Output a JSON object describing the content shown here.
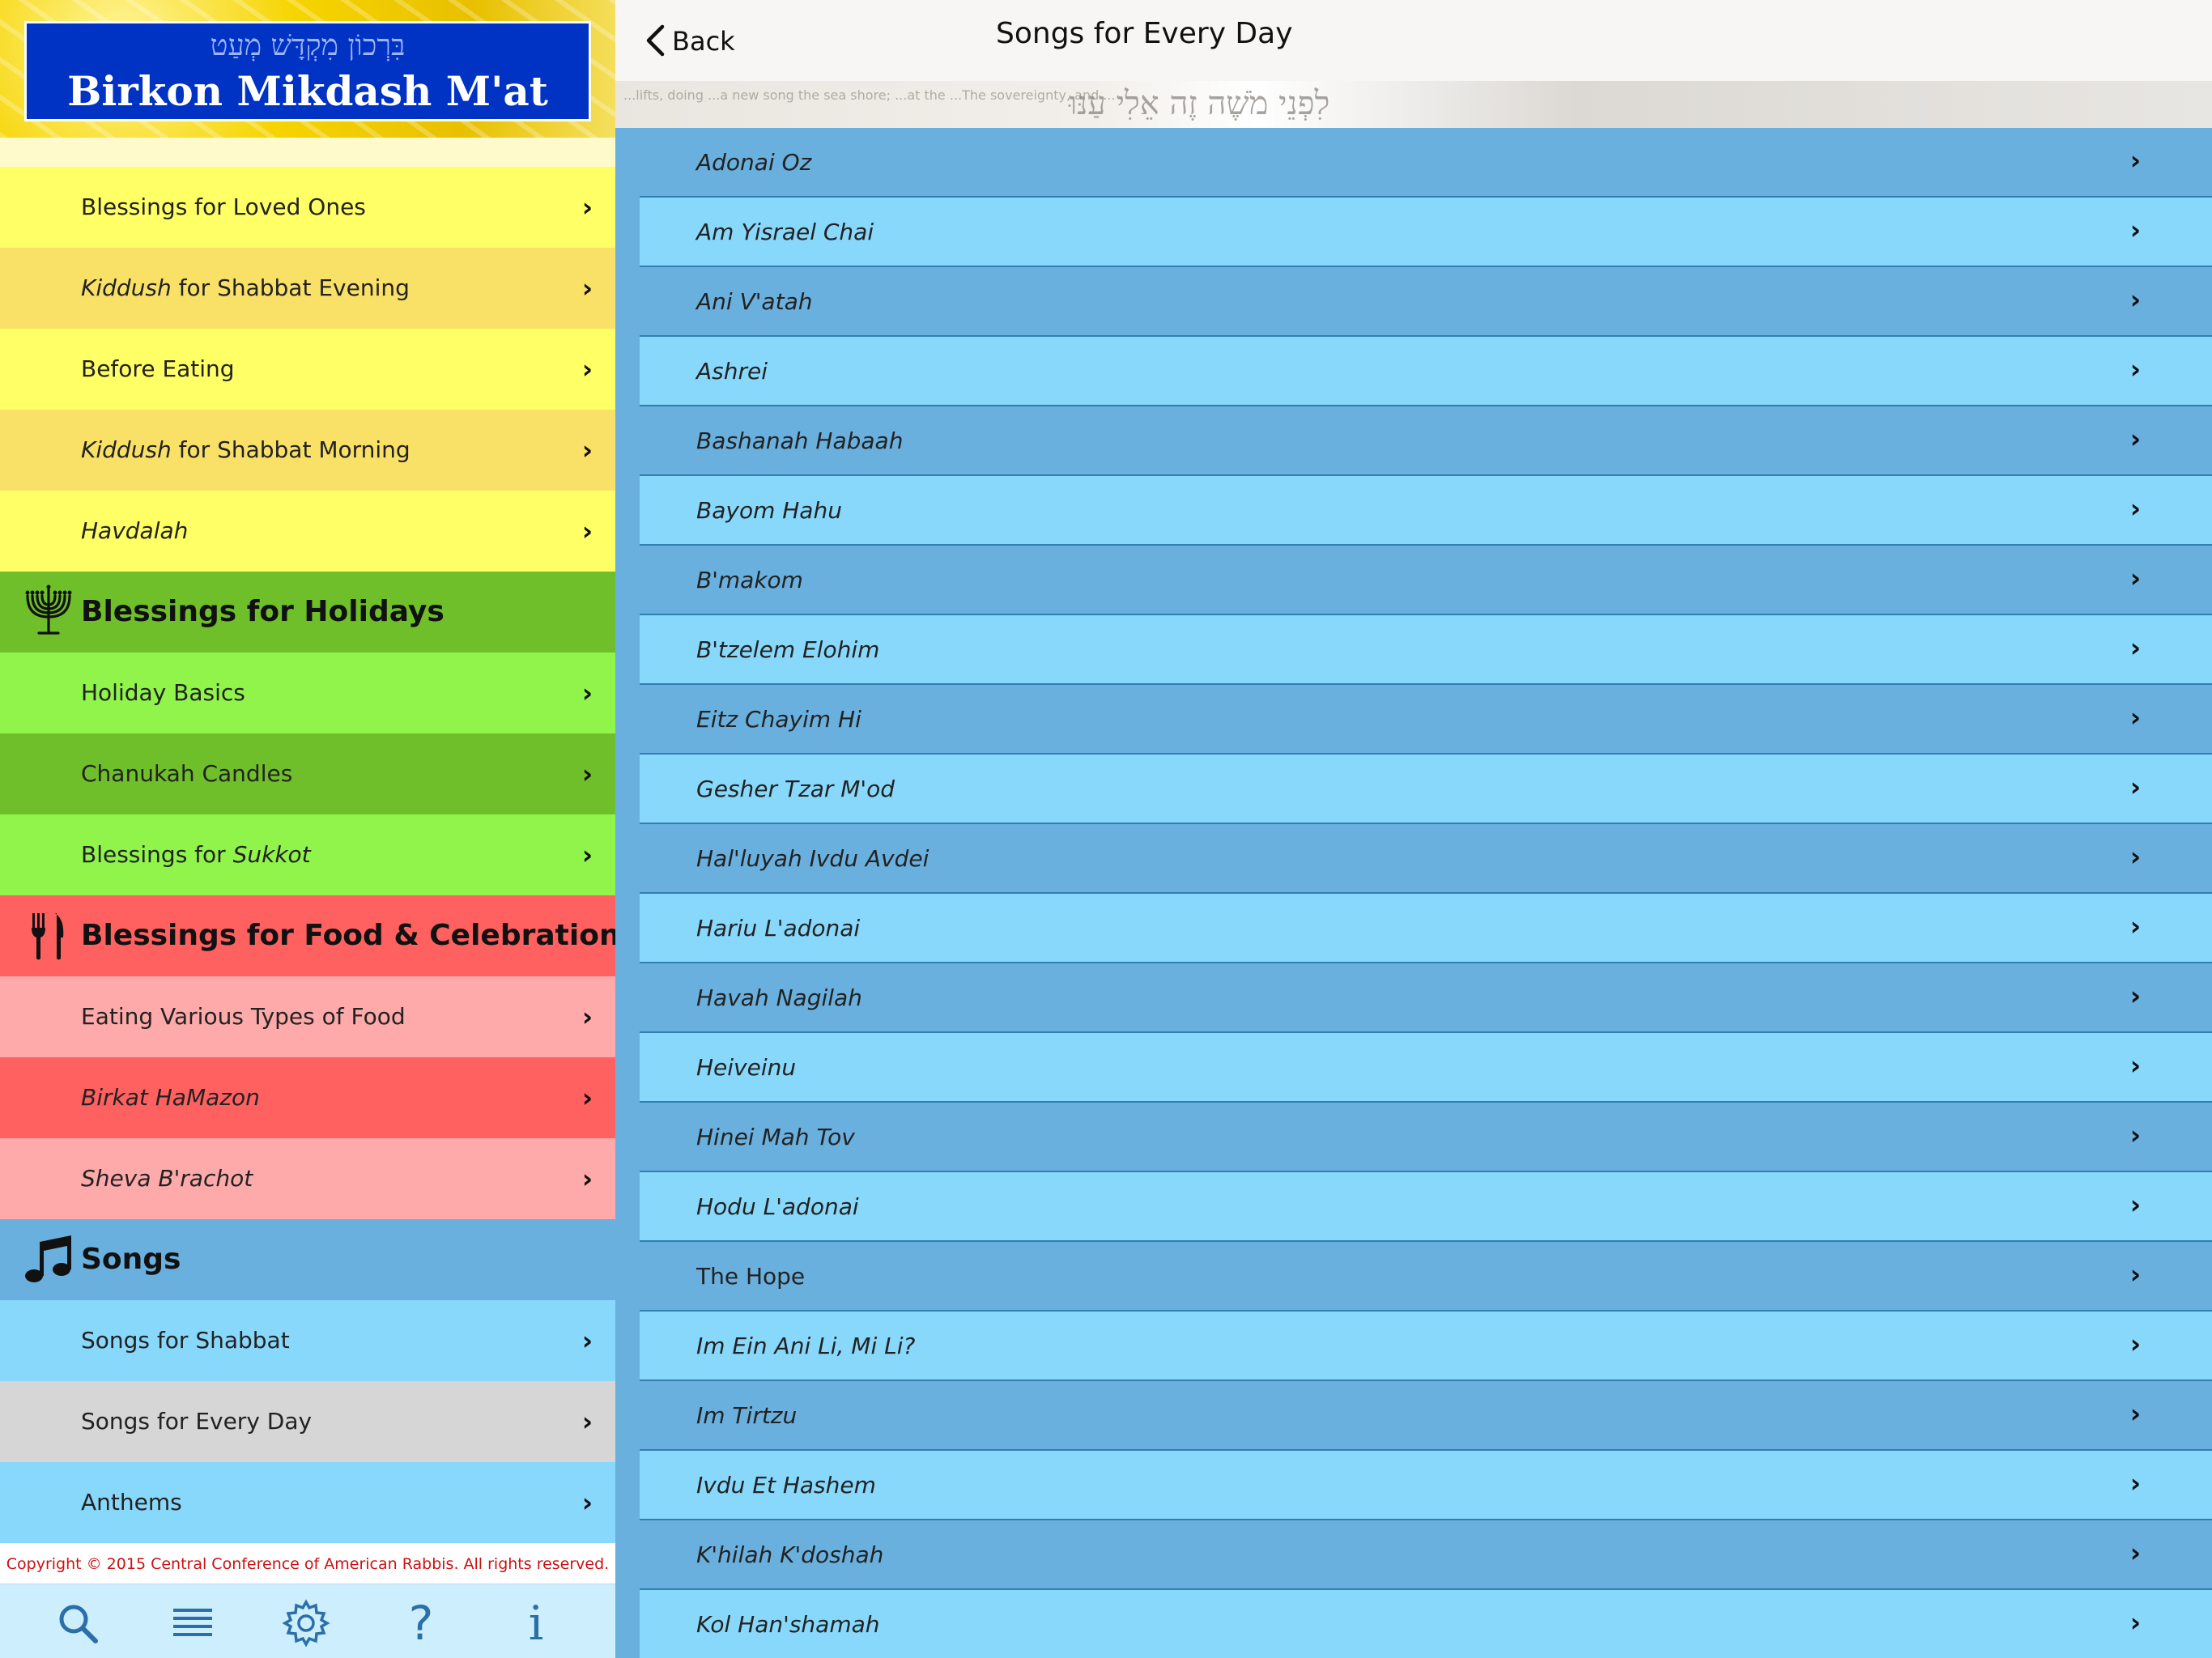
{
  "banner": {
    "hebrew": "בִּרְכוֹן מִקְדָּשׁ מְעַט",
    "title": "Birkon Mikdash M'at"
  },
  "sidebar": {
    "items": [
      {
        "pre": "Blessings for Loved Ones",
        "it": "",
        "post": ""
      },
      {
        "pre": "",
        "it": "Kiddush",
        "post": " for Shabbat Evening"
      },
      {
        "pre": "Before Eating",
        "it": "",
        "post": ""
      },
      {
        "pre": "",
        "it": "Kiddush",
        "post": " for Shabbat Morning"
      },
      {
        "pre": "",
        "it": "Havdalah",
        "post": ""
      },
      {
        "pre": "Holiday Basics",
        "it": "",
        "post": ""
      },
      {
        "pre": "Chanukah Candles",
        "it": "",
        "post": ""
      },
      {
        "pre": "Blessings for ",
        "it": "Sukkot",
        "post": ""
      },
      {
        "pre": "Eating Various Types of Food",
        "it": "",
        "post": ""
      },
      {
        "pre": "",
        "it": "Birkat HaMazon",
        "post": ""
      },
      {
        "pre": "",
        "it": "Sheva B'rachot",
        "post": ""
      },
      {
        "pre": "Songs for Shabbat",
        "it": "",
        "post": ""
      },
      {
        "pre": "Songs for Every Day",
        "it": "",
        "post": ""
      },
      {
        "pre": "Anthems",
        "it": "",
        "post": ""
      }
    ],
    "headers": [
      "Blessings for Holidays",
      "Blessings for Food & Celebration",
      "Songs"
    ],
    "chevron": "›",
    "copyright": "Copyright © 2015 Central Conference of American Rabbis. All rights reserved."
  },
  "tabbar": {
    "icons": [
      "search-icon",
      "list-icon",
      "gear-icon",
      "help-icon",
      "info-icon"
    ],
    "help_glyph": "?",
    "info_glyph": "i"
  },
  "navbar": {
    "back_label": "Back",
    "title": "Songs for Every Day"
  },
  "photo": {
    "hebrew": "לִפְנֵי מֹשֶׁה זֶה אֵלִי עַנּוּ",
    "fine": "...lifts, doing ...a new song the sea shore; ...at the ...The sovereignty, and ..."
  },
  "songs": [
    {
      "name": "Adonai Oz",
      "italic": true
    },
    {
      "name": "Am Yisrael Chai",
      "italic": true
    },
    {
      "name": "Ani V'atah",
      "italic": true
    },
    {
      "name": "Ashrei",
      "italic": true
    },
    {
      "name": "Bashanah Habaah",
      "italic": true
    },
    {
      "name": "Bayom Hahu",
      "italic": true
    },
    {
      "name": "B'makom",
      "italic": true
    },
    {
      "name": "B'tzelem Elohim",
      "italic": true
    },
    {
      "name": "Eitz Chayim Hi",
      "italic": true
    },
    {
      "name": "Gesher Tzar M'od",
      "italic": true
    },
    {
      "name": "Hal'luyah Ivdu Avdei",
      "italic": true
    },
    {
      "name": "Hariu L'adonai",
      "italic": true
    },
    {
      "name": "Havah Nagilah",
      "italic": true
    },
    {
      "name": "Heiveinu",
      "italic": true
    },
    {
      "name": "Hinei Mah Tov",
      "italic": true
    },
    {
      "name": "Hodu L'adonai",
      "italic": true
    },
    {
      "name": "The Hope",
      "italic": false
    },
    {
      "name": "Im Ein Ani Li, Mi Li?",
      "italic": true
    },
    {
      "name": "Im Tirtzu",
      "italic": true
    },
    {
      "name": "Ivdu Et Hashem",
      "italic": true
    },
    {
      "name": "K'hilah K'doshah",
      "italic": true
    },
    {
      "name": "Kol Han'shamah",
      "italic": true
    }
  ],
  "colors": {
    "yellow": "#ffff66",
    "green": "#90f44b",
    "red": "#ff6060",
    "blue": "#6ab0de",
    "light_blue": "#88d8fc",
    "banner_blue": "#0033c4",
    "copyright_red": "#cc1111"
  }
}
